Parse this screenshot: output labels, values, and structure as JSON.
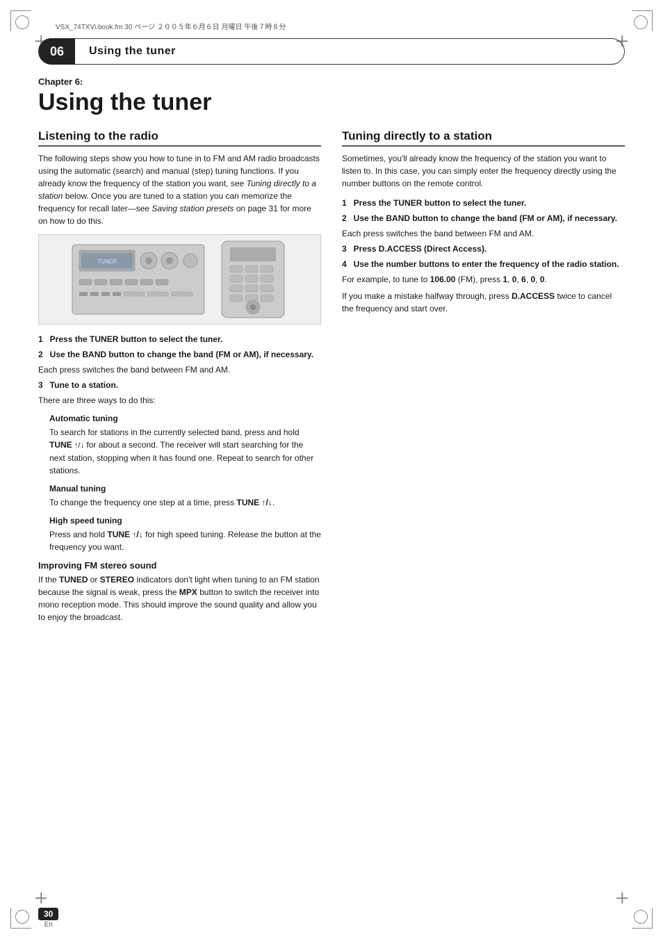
{
  "page": {
    "number": "30",
    "lang": "En",
    "file_info": "VSX_74TXVi.book.fm  30 ページ  ２００５年６月６日  月曜日  午後７時８分"
  },
  "header": {
    "chapter_num": "06",
    "title": "Using the tuner"
  },
  "chapter": {
    "label": "Chapter 6:",
    "heading": "Using the tuner"
  },
  "left_column": {
    "section_title": "Listening to the radio",
    "intro": "The following steps show you how to tune in to FM and AM radio broadcasts using the automatic (search) and manual (step) tuning functions. If you already know the frequency of the station you want, see Tuning directly to a station below. Once you are tuned to a station you can memorize the frequency for recall later—see Saving station presets on page 31 for more on how to do this.",
    "steps": [
      {
        "num": "1",
        "text": "Press the TUNER button to select the tuner."
      },
      {
        "num": "2",
        "text": "Use the BAND button to change the band (FM or AM), if necessary.",
        "sub": "Each press switches the band between FM and AM."
      },
      {
        "num": "3",
        "text": "Tune to a station.",
        "sub": "There are three ways to do this:"
      }
    ],
    "tuning_methods": [
      {
        "title": "Automatic tuning",
        "text": "To search for stations in the currently selected band, press and hold TUNE ↑/↓ for about a second. The receiver will start searching for the next station, stopping when it has found one. Repeat to search for other stations."
      },
      {
        "title": "Manual tuning",
        "text": "To change the frequency one step at a time, press TUNE ↑/↓."
      },
      {
        "title": "High speed tuning",
        "text": "Press and hold TUNE ↑/↓ for high speed tuning. Release the button at the frequency you want."
      }
    ],
    "fm_section": {
      "title": "Improving FM stereo sound",
      "text": "If the TUNED or STEREO indicators don't light when tuning to an FM station because the signal is weak, press the MPX button to switch the receiver into mono reception mode. This should improve the sound quality and allow you to enjoy the broadcast."
    }
  },
  "right_column": {
    "section_title": "Tuning directly to a station",
    "intro": "Sometimes, you'll already know the frequency of the station you want to listen to. In this case, you can simply enter the frequency directly using the number buttons on the remote control.",
    "steps": [
      {
        "num": "1",
        "text": "Press the TUNER button to select the tuner."
      },
      {
        "num": "2",
        "text": "Use the BAND button to change the band (FM or AM), if necessary.",
        "sub": "Each press switches the band between FM and AM."
      },
      {
        "num": "3",
        "text": "Press D.ACCESS (Direct Access)."
      },
      {
        "num": "4",
        "text": "Use the number buttons to enter the frequency of the radio station.",
        "sub": "For example, to tune to 106.00 (FM), press 1, 0, 6, 0, 0.",
        "note": "If you make a mistake halfway through, press D.ACCESS twice to cancel the frequency and start over."
      }
    ]
  }
}
